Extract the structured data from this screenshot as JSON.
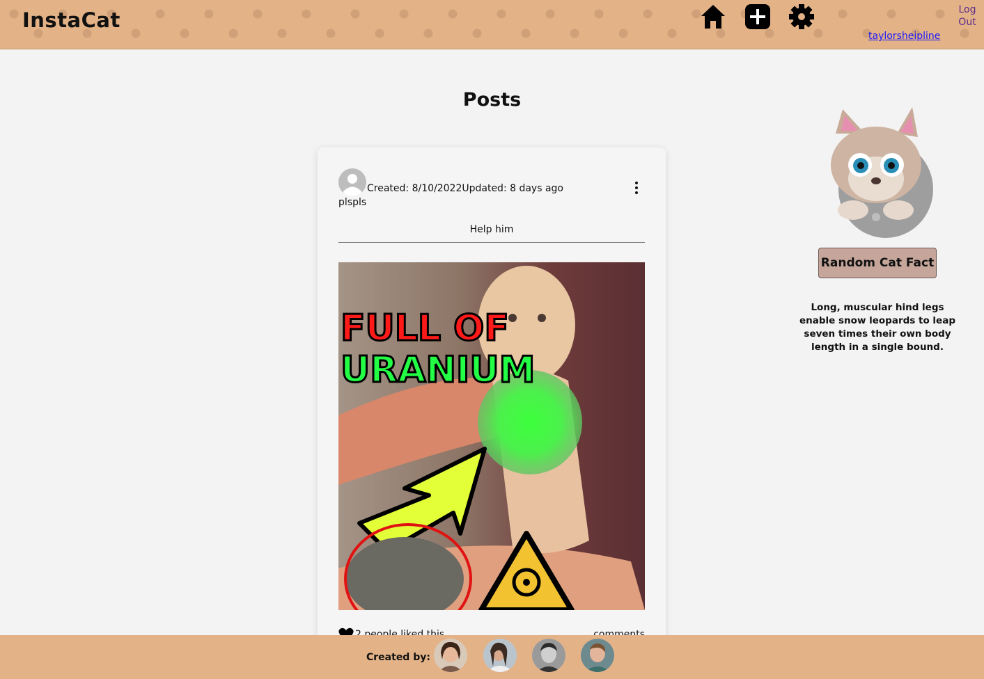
{
  "app": {
    "title": "InstaCat"
  },
  "header": {
    "icons": [
      "home-icon",
      "add-post-icon",
      "settings-icon"
    ],
    "username": "taylorsheipline",
    "logout_label": "Log Out"
  },
  "main": {
    "title": "Posts"
  },
  "post": {
    "meta": "Created: 8/10/2022Updated: 8 days ago",
    "author": "plspls",
    "caption": "Help him",
    "image_text_line1": "FULL OF",
    "image_text_line2": "URANIUM",
    "likes": "2 people liked this",
    "comments_label": "comments"
  },
  "sidebar": {
    "fact_button_label": "Random Cat Fact",
    "fact_text": "Long, muscular hind legs enable snow leopards to leap seven times their own body length in a single bound."
  },
  "footer": {
    "label": "Created by:",
    "creators": [
      "creator-1",
      "creator-2",
      "creator-3",
      "creator-4"
    ]
  },
  "colors": {
    "header_bg": "#e3b287",
    "button_bg": "#c6a69b",
    "link": "#1a1aff",
    "logout": "#5b2b8a"
  }
}
